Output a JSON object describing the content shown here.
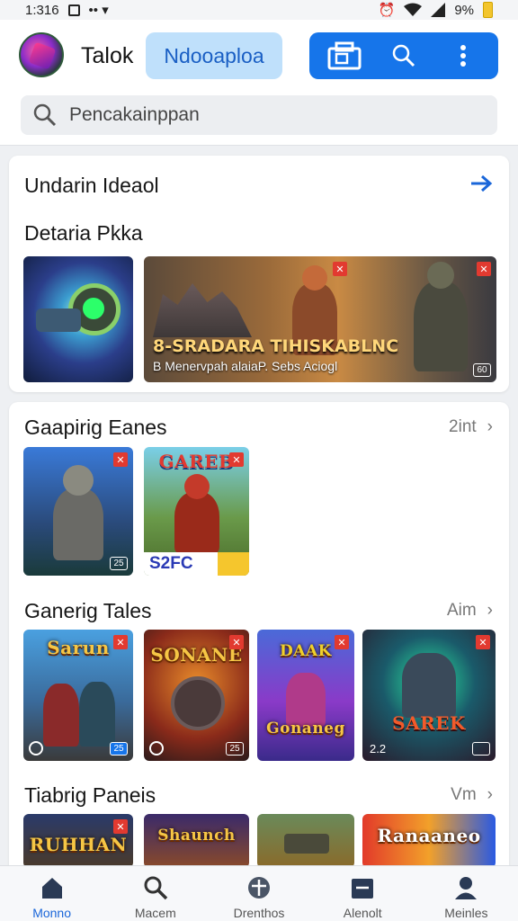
{
  "status_bar": {
    "time": "1:316",
    "battery_text": "9%"
  },
  "header": {
    "title": "Talok",
    "tab_label": "Ndooaploa",
    "search_placeholder": "Pencakainppan"
  },
  "featured": {
    "heading": "Undarin Ideaol",
    "subheading": "Detaria Pkka",
    "banner_title": "8-SRADARA TIHISKABLNC",
    "banner_subtitle": "B Menervpah alaiaP. Sebs Aciogl",
    "banner_corner": "60"
  },
  "sections": [
    {
      "title": "Gaapirig Eanes",
      "more": "2int",
      "games": [
        {
          "name": "",
          "badge": "25"
        },
        {
          "name": "GAREB",
          "bottom": "S2FC"
        }
      ]
    },
    {
      "title": "Ganerig Tales",
      "more": "Aim",
      "games": [
        {
          "name": "Sarun",
          "badge": "25"
        },
        {
          "name": "SONANE",
          "badge": "25"
        },
        {
          "name": "Gonaneg",
          "top": "DAAK"
        },
        {
          "name": "SAREK",
          "badge": "2.2"
        }
      ]
    },
    {
      "title": "Tiabrig Paneis",
      "more": "Vm",
      "games": [
        {
          "name": "RUHHAN"
        },
        {
          "name": "Shaunch"
        },
        {
          "name": ""
        },
        {
          "name": "Ranaaneo"
        }
      ]
    }
  ],
  "bottom_nav": [
    {
      "label": "Monno",
      "icon": "home-icon"
    },
    {
      "label": "Macem",
      "icon": "search-icon"
    },
    {
      "label": "Drenthos",
      "icon": "compass-icon"
    },
    {
      "label": "Alenolt",
      "icon": "library-icon"
    },
    {
      "label": "Meinles",
      "icon": "profile-icon"
    }
  ],
  "colors": {
    "accent": "#1675ea",
    "pill_bg": "#bfe0fb",
    "active_nav": "#1a66d9"
  }
}
